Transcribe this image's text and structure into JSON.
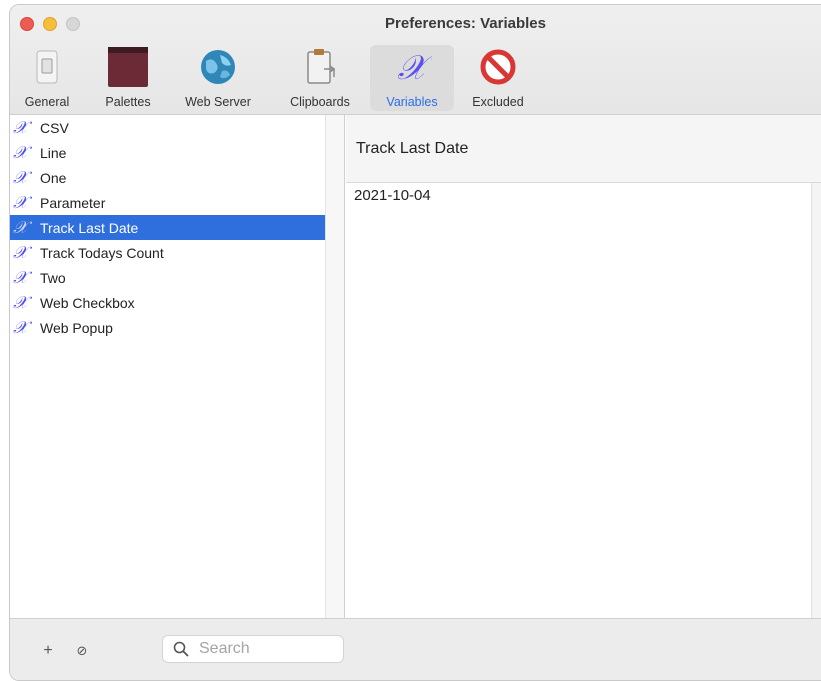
{
  "window": {
    "title": "Preferences: Variables"
  },
  "toolbar": {
    "items": [
      {
        "label": "General",
        "icon": "switch-icon"
      },
      {
        "label": "Palettes",
        "icon": "palette-icon"
      },
      {
        "label": "Web Server",
        "icon": "globe-icon"
      },
      {
        "label": "Clipboards",
        "icon": "clipboard-icon"
      },
      {
        "label": "Variables",
        "icon": "variable-x-icon",
        "active": true
      },
      {
        "label": "Excluded",
        "icon": "prohibited-icon"
      }
    ]
  },
  "variables": {
    "glyph": "𝒳",
    "items": [
      "CSV",
      "Line",
      "One",
      "Parameter",
      "Track Last Date",
      "Track Todays Count",
      "Two",
      "Web Checkbox",
      "Web Popup"
    ],
    "selected_index": 4
  },
  "detail": {
    "title": "Track Last Date",
    "value": "2021-10-04"
  },
  "footer": {
    "add_label": "+",
    "remove_label": "⊘",
    "search_placeholder": "Search"
  },
  "colors": {
    "accent": "#2a6ee8",
    "selection": "#2f6fdd"
  }
}
